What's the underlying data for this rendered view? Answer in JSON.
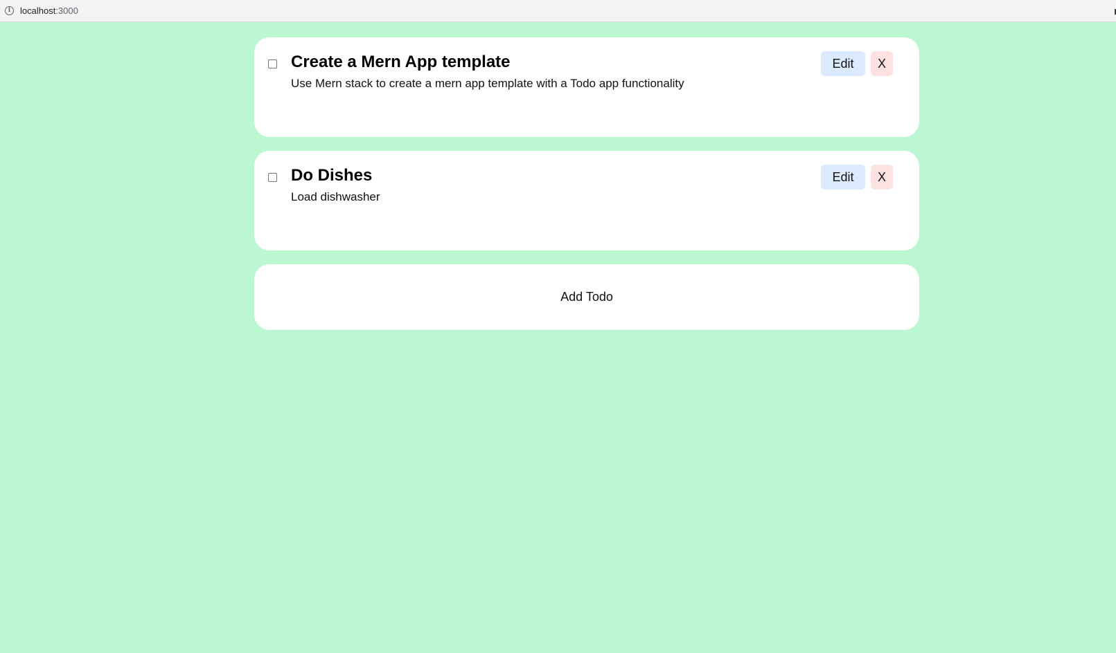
{
  "browser": {
    "url_host": "localhost",
    "url_port": ":3000",
    "info_icon_symbol": "i"
  },
  "todos": [
    {
      "title": "Create a Mern App template",
      "description": "Use Mern stack to create a mern app template with a Todo app functionality",
      "completed": false,
      "edit_label": "Edit",
      "delete_label": "X"
    },
    {
      "title": "Do Dishes",
      "description": "Load dishwasher",
      "completed": false,
      "edit_label": "Edit",
      "delete_label": "X"
    }
  ],
  "add_todo": {
    "label": "Add Todo"
  },
  "colors": {
    "background": "#bbf7d0",
    "card": "#ffffff",
    "edit_button": "#dbeafe",
    "delete_button": "#fee2e2"
  }
}
